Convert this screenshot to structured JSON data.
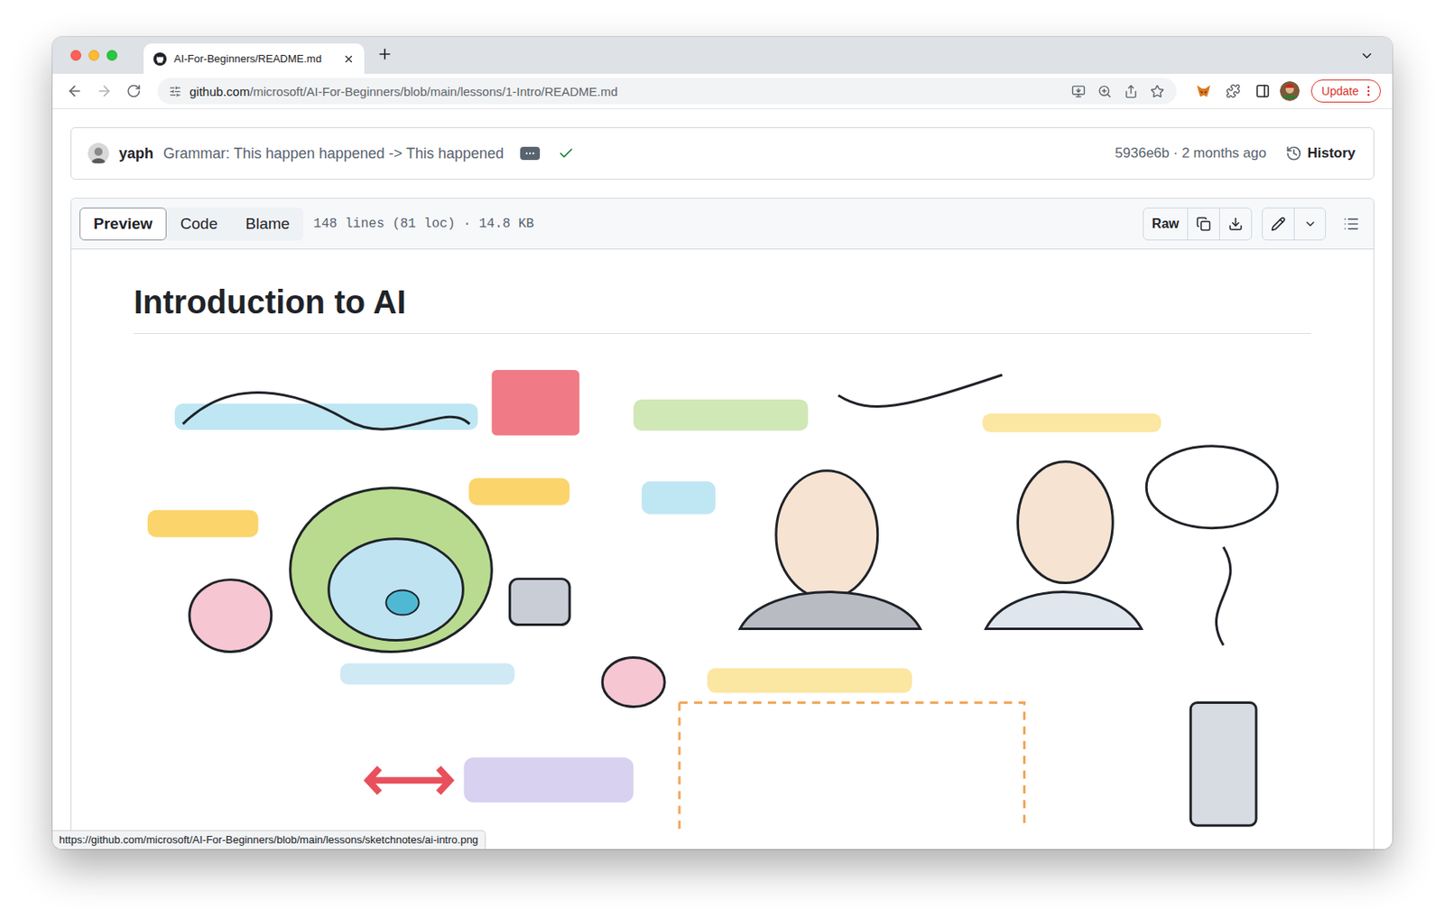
{
  "window": {
    "tab_title": "AI-For-Beginners/README.md"
  },
  "address_bar": {
    "url_host": "github.com",
    "url_path": "/microsoft/AI-For-Beginners/blob/main/lessons/1-Intro/README.md"
  },
  "update_button": "Update",
  "commit": {
    "author": "yaph",
    "message": "Grammar: This happen happened -> This happened",
    "passed": true,
    "hash": "5936e6b",
    "separator": "·",
    "time": "2 months ago",
    "history": "History"
  },
  "file": {
    "tabs": [
      {
        "label": "Preview",
        "selected": true
      },
      {
        "label": "Code",
        "selected": false
      },
      {
        "label": "Blame",
        "selected": false
      }
    ],
    "info": "148 lines (81 loc) · 14.8 KB",
    "raw": "Raw"
  },
  "document": {
    "heading": "Introduction to AI"
  },
  "status_link": "https://github.com/microsoft/AI-For-Beginners/blob/main/lessons/sketchnotes/ai-intro.png"
}
